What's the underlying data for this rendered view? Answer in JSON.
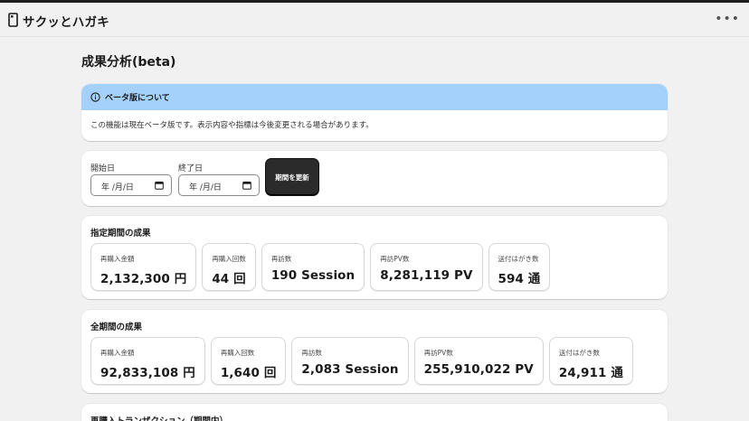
{
  "app": {
    "title": "サクッとハガキ",
    "menu_icon": "more-icon"
  },
  "page": {
    "title": "成果分析(beta)"
  },
  "notice": {
    "icon": "info-icon",
    "title": "ベータ版について",
    "body": "この機能は現在ベータ版です。表示内容や指標は今後変更される場合があります。"
  },
  "filters": {
    "start_label": "開始日",
    "start_value": "年 /月/日",
    "end_label": "終了日",
    "end_value": "年 /月/日",
    "update_button": "期間を更新"
  },
  "period_results": {
    "title": "指定期間の成果",
    "metrics": [
      {
        "label": "再購入金額",
        "value": "2,132,300 円"
      },
      {
        "label": "再購入回数",
        "value": "44 回"
      },
      {
        "label": "再訪数",
        "value": "190 Session"
      },
      {
        "label": "再訪PV数",
        "value": "8,281,119 PV"
      },
      {
        "label": "送付はがき数",
        "value": "594 通"
      }
    ]
  },
  "all_results": {
    "title": "全期間の成果",
    "metrics": [
      {
        "label": "再購入金額",
        "value": "92,833,108 円"
      },
      {
        "label": "再購入回数",
        "value": "1,640 回"
      },
      {
        "label": "再訪数",
        "value": "2,083 Session"
      },
      {
        "label": "再訪PV数",
        "value": "255,910,022 PV"
      },
      {
        "label": "送付はがき数",
        "value": "24,911 通"
      }
    ]
  },
  "transactions": {
    "title": "再購入トランザクション（期間内）"
  }
}
